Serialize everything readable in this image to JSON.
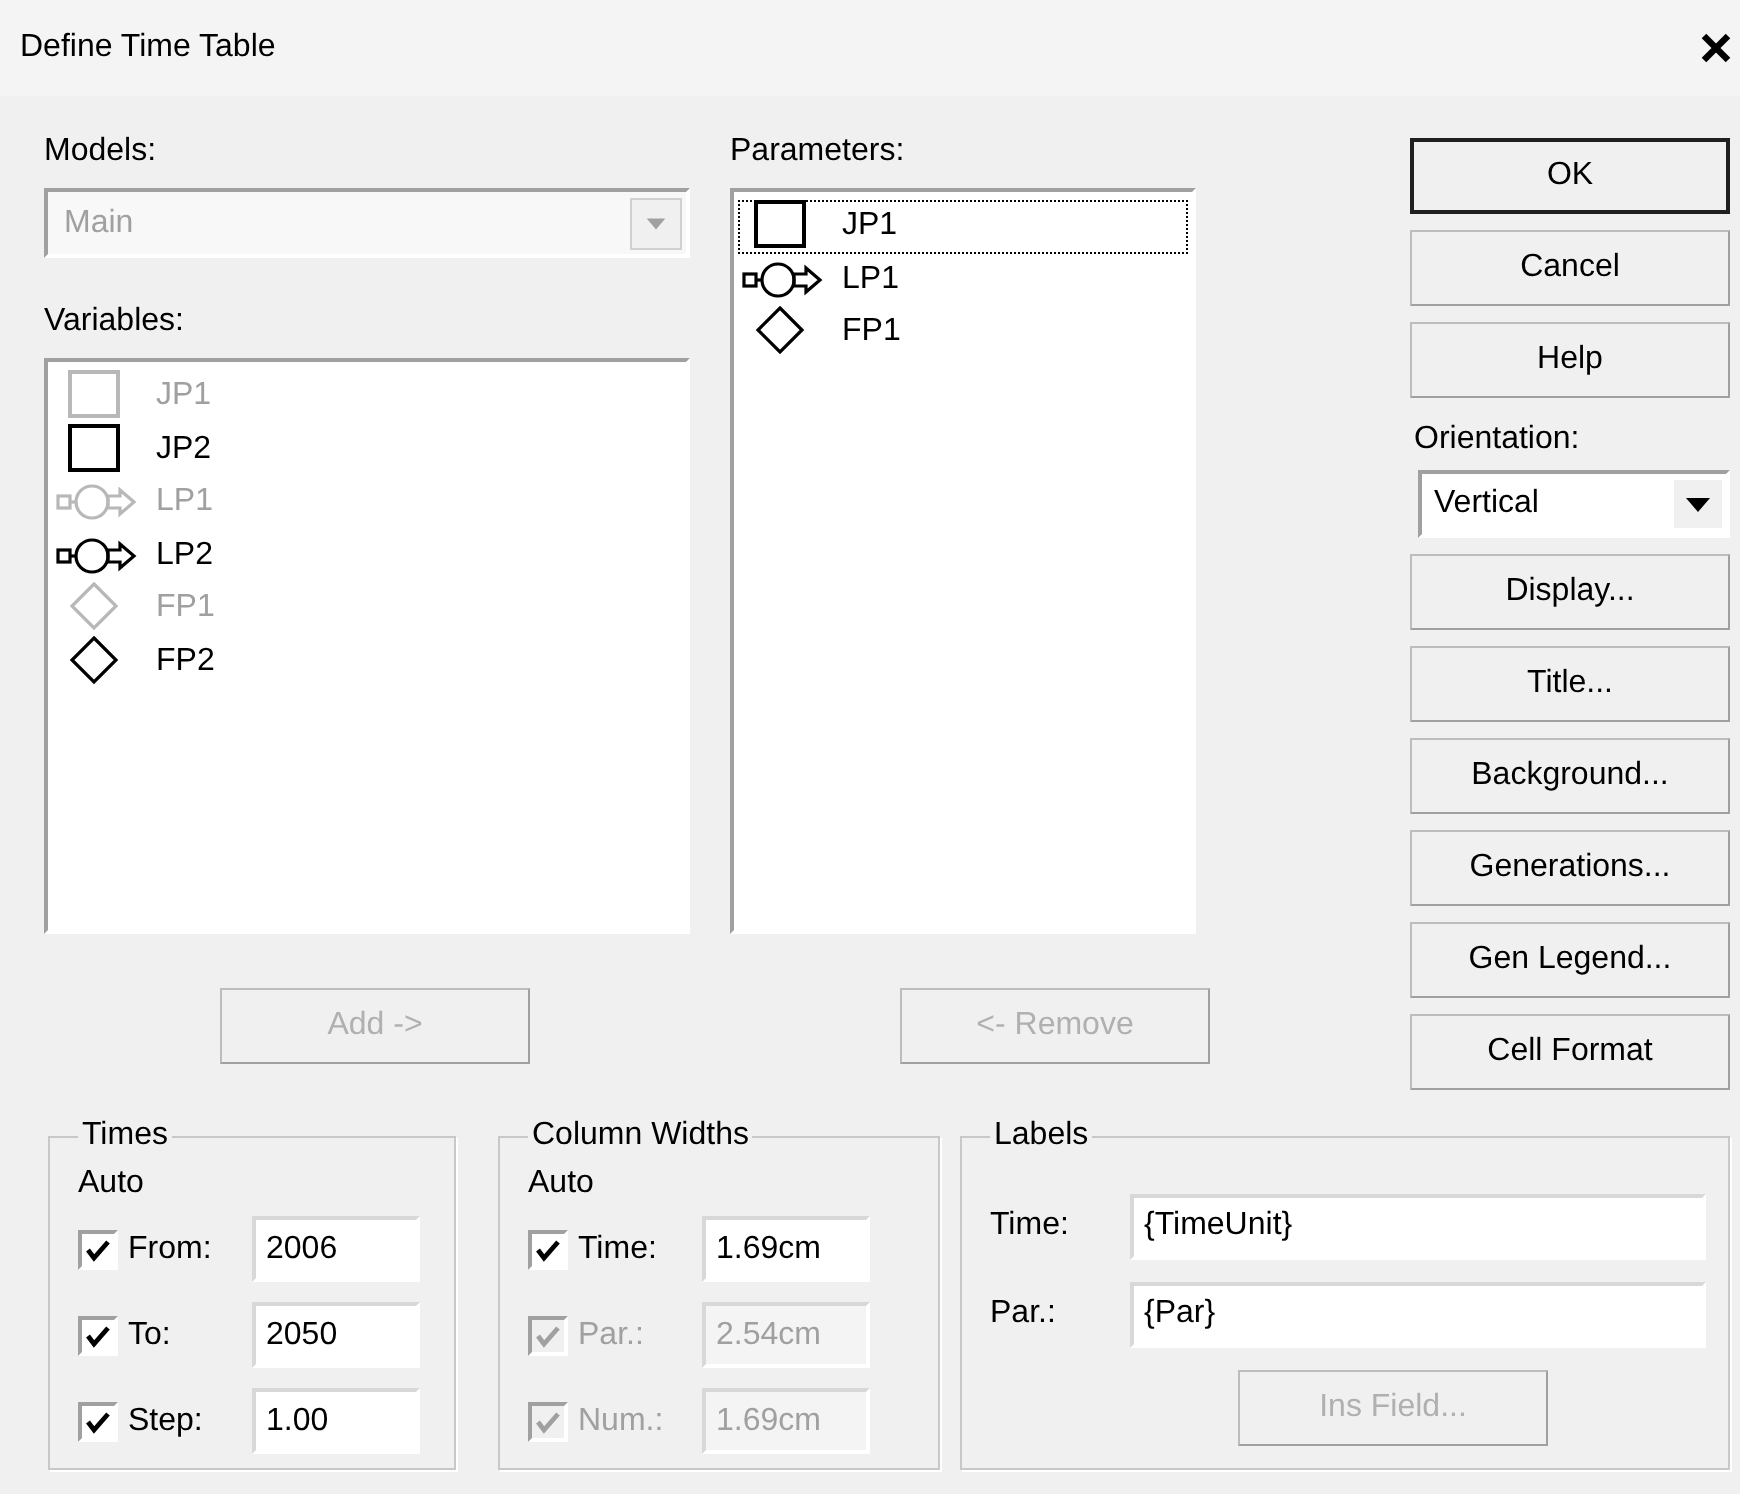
{
  "window": {
    "title": "Define Time Table"
  },
  "models": {
    "label": "Models:",
    "dropdown": {
      "value": "Main",
      "disabled": true
    }
  },
  "variables": {
    "label": "Variables:",
    "items": [
      {
        "kind": "square",
        "label": "JP1",
        "disabled": true
      },
      {
        "kind": "square",
        "label": "JP2",
        "disabled": false
      },
      {
        "kind": "valve",
        "label": "LP1",
        "disabled": true
      },
      {
        "kind": "valve",
        "label": "LP2",
        "disabled": false
      },
      {
        "kind": "diamond",
        "label": "FP1",
        "disabled": true
      },
      {
        "kind": "diamond",
        "label": "FP2",
        "disabled": false
      }
    ]
  },
  "add_button": {
    "label": "Add ->",
    "disabled": true
  },
  "parameters": {
    "label": "Parameters:",
    "items": [
      {
        "kind": "square",
        "label": "JP1",
        "selected": true
      },
      {
        "kind": "valve",
        "label": "LP1",
        "selected": false
      },
      {
        "kind": "diamond",
        "label": "FP1",
        "selected": false
      }
    ]
  },
  "remove_button": {
    "label": "<- Remove",
    "disabled": true
  },
  "side_buttons_top": [
    {
      "label": "OK",
      "default": true
    },
    {
      "label": "Cancel",
      "default": false
    },
    {
      "label": "Help",
      "default": false
    }
  ],
  "orientation": {
    "label": "Orientation:",
    "value": "Vertical"
  },
  "side_buttons_bottom": [
    {
      "label": "Display...",
      "default": false
    },
    {
      "label": "Title...",
      "default": false
    },
    {
      "label": "Background...",
      "default": false
    },
    {
      "label": "Generations...",
      "default": false
    },
    {
      "label": "Gen Legend...",
      "default": false
    },
    {
      "label": "Cell Format",
      "default": false
    }
  ],
  "times": {
    "title": "Times",
    "auto_label": "Auto",
    "rows": [
      {
        "label": "From:",
        "checked": true,
        "disabled": false,
        "value": "2006"
      },
      {
        "label": "To:",
        "checked": true,
        "disabled": false,
        "value": "2050"
      },
      {
        "label": "Step:",
        "checked": true,
        "disabled": false,
        "value": "1.00"
      }
    ]
  },
  "column_widths": {
    "title": "Column Widths",
    "auto_label": "Auto",
    "rows": [
      {
        "label": "Time:",
        "checked": true,
        "disabled": false,
        "value": "1.69cm"
      },
      {
        "label": "Par.:",
        "checked": true,
        "disabled": true,
        "value": "2.54cm"
      },
      {
        "label": "Num.:",
        "checked": true,
        "disabled": true,
        "value": "1.69cm"
      }
    ]
  },
  "labels": {
    "title": "Labels",
    "rows": [
      {
        "label": "Time:",
        "value": "{TimeUnit}"
      },
      {
        "label": "Par.:",
        "value": "{Par}"
      }
    ],
    "button": {
      "label": "Ins Field...",
      "disabled": true
    }
  }
}
